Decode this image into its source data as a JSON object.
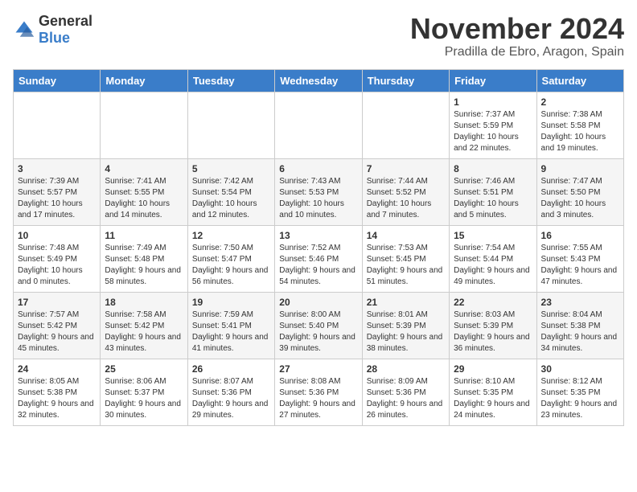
{
  "logo": {
    "text_general": "General",
    "text_blue": "Blue"
  },
  "header": {
    "month": "November 2024",
    "location": "Pradilla de Ebro, Aragon, Spain"
  },
  "days_of_week": [
    "Sunday",
    "Monday",
    "Tuesday",
    "Wednesday",
    "Thursday",
    "Friday",
    "Saturday"
  ],
  "weeks": [
    [
      {
        "day": "",
        "info": ""
      },
      {
        "day": "",
        "info": ""
      },
      {
        "day": "",
        "info": ""
      },
      {
        "day": "",
        "info": ""
      },
      {
        "day": "",
        "info": ""
      },
      {
        "day": "1",
        "info": "Sunrise: 7:37 AM\nSunset: 5:59 PM\nDaylight: 10 hours and 22 minutes."
      },
      {
        "day": "2",
        "info": "Sunrise: 7:38 AM\nSunset: 5:58 PM\nDaylight: 10 hours and 19 minutes."
      }
    ],
    [
      {
        "day": "3",
        "info": "Sunrise: 7:39 AM\nSunset: 5:57 PM\nDaylight: 10 hours and 17 minutes."
      },
      {
        "day": "4",
        "info": "Sunrise: 7:41 AM\nSunset: 5:55 PM\nDaylight: 10 hours and 14 minutes."
      },
      {
        "day": "5",
        "info": "Sunrise: 7:42 AM\nSunset: 5:54 PM\nDaylight: 10 hours and 12 minutes."
      },
      {
        "day": "6",
        "info": "Sunrise: 7:43 AM\nSunset: 5:53 PM\nDaylight: 10 hours and 10 minutes."
      },
      {
        "day": "7",
        "info": "Sunrise: 7:44 AM\nSunset: 5:52 PM\nDaylight: 10 hours and 7 minutes."
      },
      {
        "day": "8",
        "info": "Sunrise: 7:46 AM\nSunset: 5:51 PM\nDaylight: 10 hours and 5 minutes."
      },
      {
        "day": "9",
        "info": "Sunrise: 7:47 AM\nSunset: 5:50 PM\nDaylight: 10 hours and 3 minutes."
      }
    ],
    [
      {
        "day": "10",
        "info": "Sunrise: 7:48 AM\nSunset: 5:49 PM\nDaylight: 10 hours and 0 minutes."
      },
      {
        "day": "11",
        "info": "Sunrise: 7:49 AM\nSunset: 5:48 PM\nDaylight: 9 hours and 58 minutes."
      },
      {
        "day": "12",
        "info": "Sunrise: 7:50 AM\nSunset: 5:47 PM\nDaylight: 9 hours and 56 minutes."
      },
      {
        "day": "13",
        "info": "Sunrise: 7:52 AM\nSunset: 5:46 PM\nDaylight: 9 hours and 54 minutes."
      },
      {
        "day": "14",
        "info": "Sunrise: 7:53 AM\nSunset: 5:45 PM\nDaylight: 9 hours and 51 minutes."
      },
      {
        "day": "15",
        "info": "Sunrise: 7:54 AM\nSunset: 5:44 PM\nDaylight: 9 hours and 49 minutes."
      },
      {
        "day": "16",
        "info": "Sunrise: 7:55 AM\nSunset: 5:43 PM\nDaylight: 9 hours and 47 minutes."
      }
    ],
    [
      {
        "day": "17",
        "info": "Sunrise: 7:57 AM\nSunset: 5:42 PM\nDaylight: 9 hours and 45 minutes."
      },
      {
        "day": "18",
        "info": "Sunrise: 7:58 AM\nSunset: 5:42 PM\nDaylight: 9 hours and 43 minutes."
      },
      {
        "day": "19",
        "info": "Sunrise: 7:59 AM\nSunset: 5:41 PM\nDaylight: 9 hours and 41 minutes."
      },
      {
        "day": "20",
        "info": "Sunrise: 8:00 AM\nSunset: 5:40 PM\nDaylight: 9 hours and 39 minutes."
      },
      {
        "day": "21",
        "info": "Sunrise: 8:01 AM\nSunset: 5:39 PM\nDaylight: 9 hours and 38 minutes."
      },
      {
        "day": "22",
        "info": "Sunrise: 8:03 AM\nSunset: 5:39 PM\nDaylight: 9 hours and 36 minutes."
      },
      {
        "day": "23",
        "info": "Sunrise: 8:04 AM\nSunset: 5:38 PM\nDaylight: 9 hours and 34 minutes."
      }
    ],
    [
      {
        "day": "24",
        "info": "Sunrise: 8:05 AM\nSunset: 5:38 PM\nDaylight: 9 hours and 32 minutes."
      },
      {
        "day": "25",
        "info": "Sunrise: 8:06 AM\nSunset: 5:37 PM\nDaylight: 9 hours and 30 minutes."
      },
      {
        "day": "26",
        "info": "Sunrise: 8:07 AM\nSunset: 5:36 PM\nDaylight: 9 hours and 29 minutes."
      },
      {
        "day": "27",
        "info": "Sunrise: 8:08 AM\nSunset: 5:36 PM\nDaylight: 9 hours and 27 minutes."
      },
      {
        "day": "28",
        "info": "Sunrise: 8:09 AM\nSunset: 5:36 PM\nDaylight: 9 hours and 26 minutes."
      },
      {
        "day": "29",
        "info": "Sunrise: 8:10 AM\nSunset: 5:35 PM\nDaylight: 9 hours and 24 minutes."
      },
      {
        "day": "30",
        "info": "Sunrise: 8:12 AM\nSunset: 5:35 PM\nDaylight: 9 hours and 23 minutes."
      }
    ]
  ]
}
